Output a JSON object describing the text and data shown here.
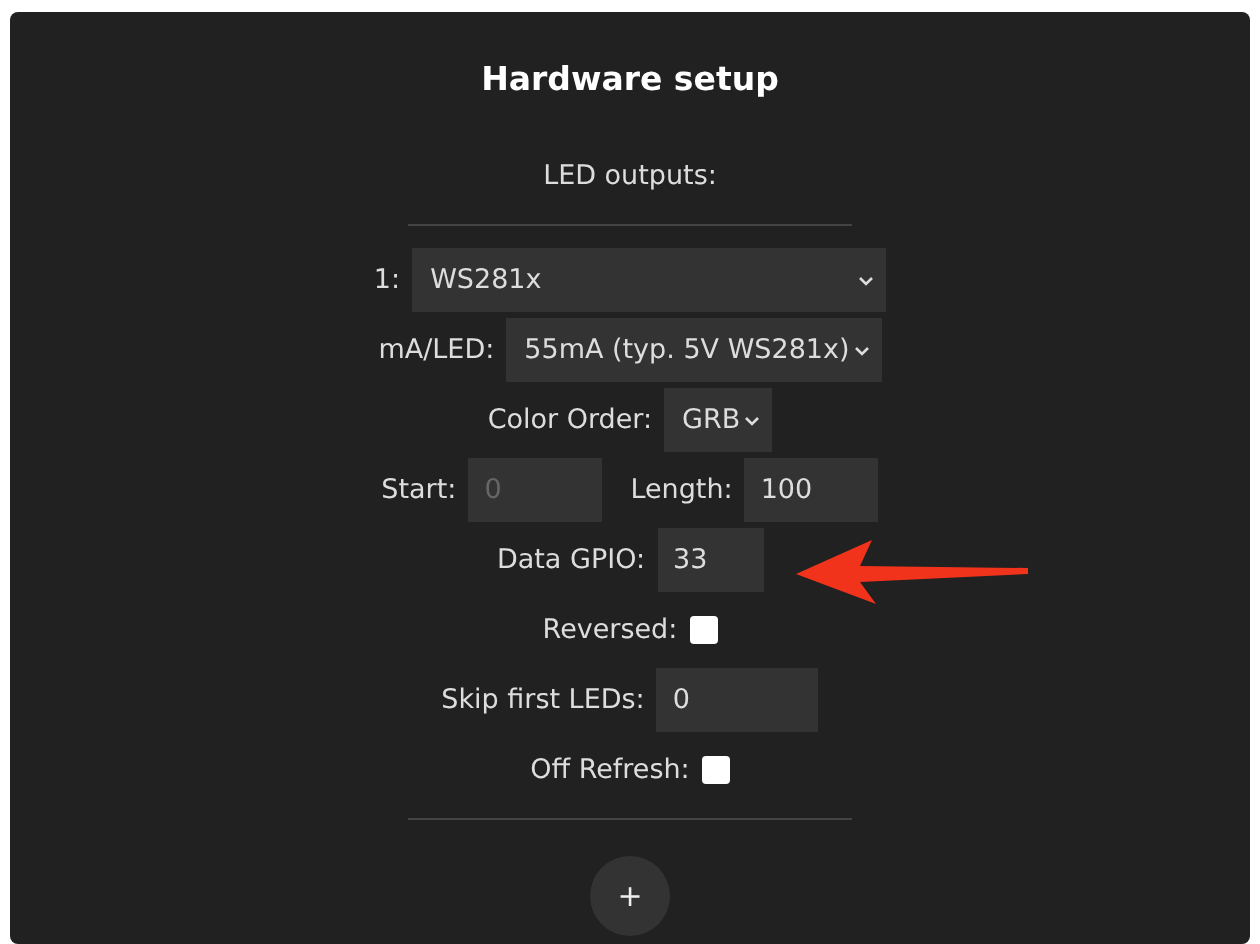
{
  "title": "Hardware setup",
  "section": "LED outputs:",
  "rows": [
    {
      "kind": "select",
      "label": "1:",
      "value": "WS281x"
    },
    {
      "kind": "select",
      "label": "mA/LED:",
      "value": "55mA (typ. 5V WS281x)"
    },
    {
      "kind": "select",
      "label": "Color Order:",
      "value": "GRB"
    },
    {
      "kind": "pair",
      "fields": [
        {
          "label": "Start:",
          "value": "0",
          "disabled": true
        },
        {
          "label": "Length:",
          "value": "100",
          "disabled": false
        }
      ]
    },
    {
      "kind": "input",
      "label": "Data GPIO:",
      "value": "33"
    },
    {
      "kind": "checkbox",
      "label": "Reversed:",
      "checked": false
    },
    {
      "kind": "input",
      "label": "Skip first LEDs:",
      "value": "0"
    },
    {
      "kind": "checkbox",
      "label": "Off Refresh:",
      "checked": false
    }
  ],
  "add_button": "+"
}
